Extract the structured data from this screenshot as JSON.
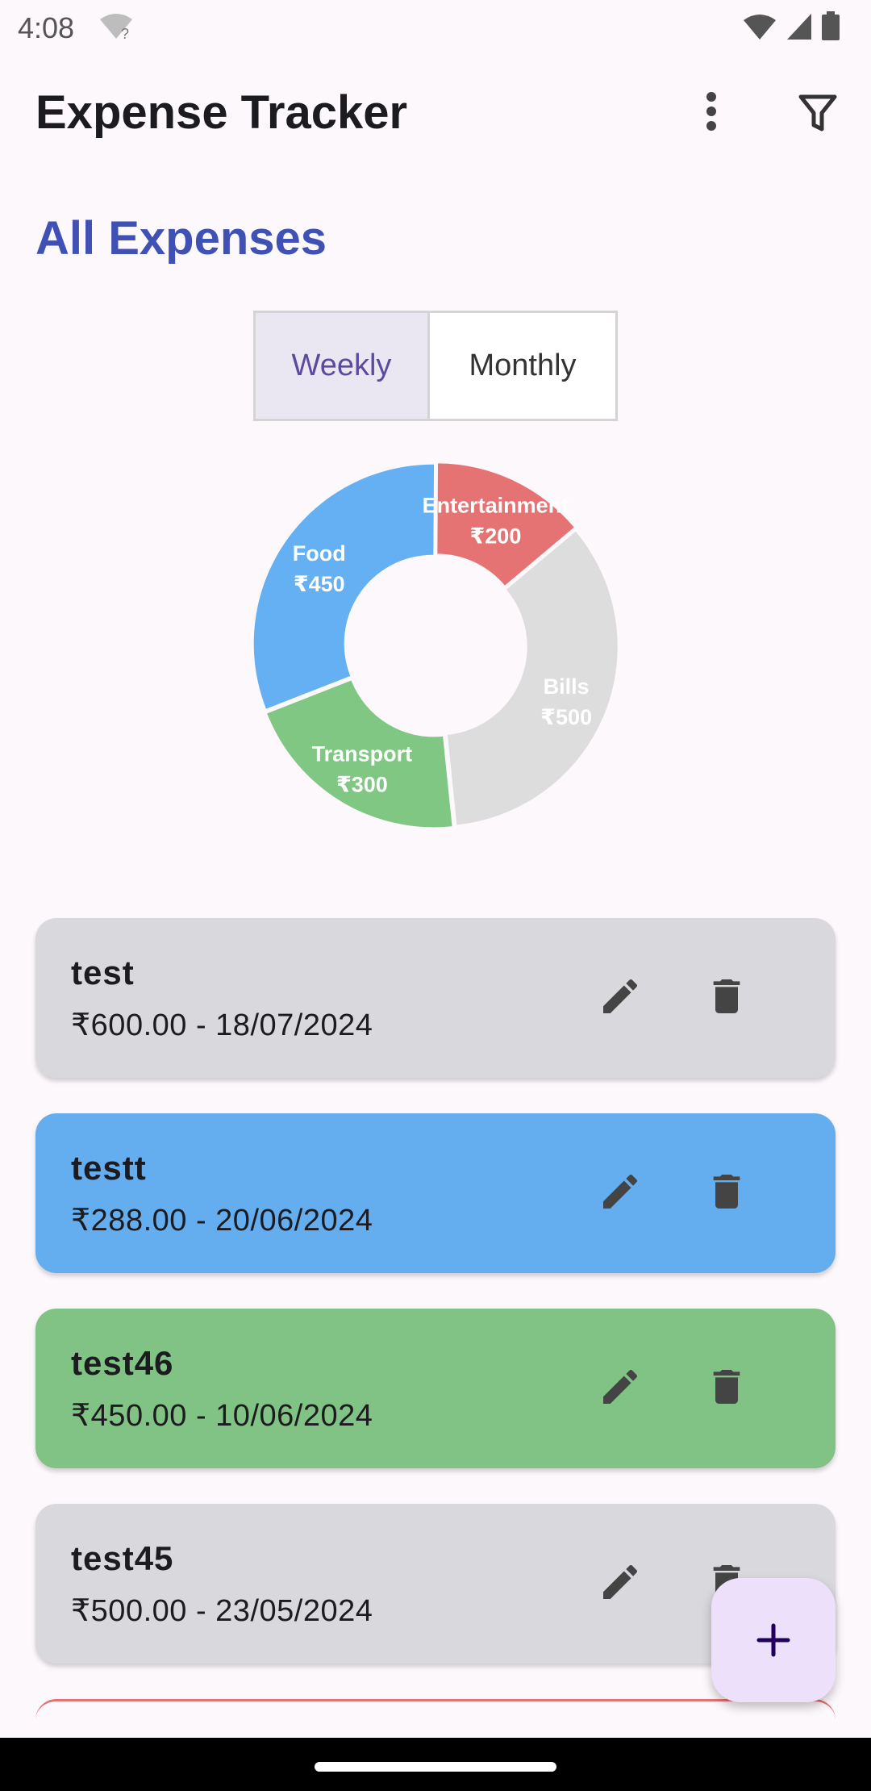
{
  "status_bar": {
    "time": "4:08"
  },
  "app_bar": {
    "title": "Expense Tracker"
  },
  "section": {
    "title": "All Expenses"
  },
  "segmented": {
    "weekly": "Weekly",
    "monthly": "Monthly",
    "selected": "Weekly"
  },
  "chart_data": {
    "type": "pie",
    "donut": true,
    "slices": [
      {
        "name": "Bills",
        "value_label": "₹500",
        "value": 500,
        "color": "#dddddd"
      },
      {
        "name": "Transport",
        "value_label": "₹300",
        "value": 300,
        "color": "#81c784"
      },
      {
        "name": "Food",
        "value_label": "₹450",
        "value": 450,
        "color": "#64b0f2"
      },
      {
        "name": "Entertainment",
        "value_label": "₹200",
        "value": 200,
        "color": "#e57373"
      }
    ]
  },
  "expenses": [
    {
      "title": "test",
      "subtitle": "₹600.00 - 18/07/2024",
      "color": "#d9d8dc"
    },
    {
      "title": "testt",
      "subtitle": "₹288.00 - 20/06/2024",
      "color": "#64aef0"
    },
    {
      "title": "test46",
      "subtitle": "₹450.00 - 10/06/2024",
      "color": "#81c384"
    },
    {
      "title": "test45",
      "subtitle": "₹500.00 - 23/05/2024",
      "color": "#d9d8dc"
    }
  ],
  "icons": {
    "more": "more-vert-icon",
    "filter": "filter-icon",
    "edit": "pencil-icon",
    "delete": "trash-icon",
    "add": "plus-icon"
  }
}
